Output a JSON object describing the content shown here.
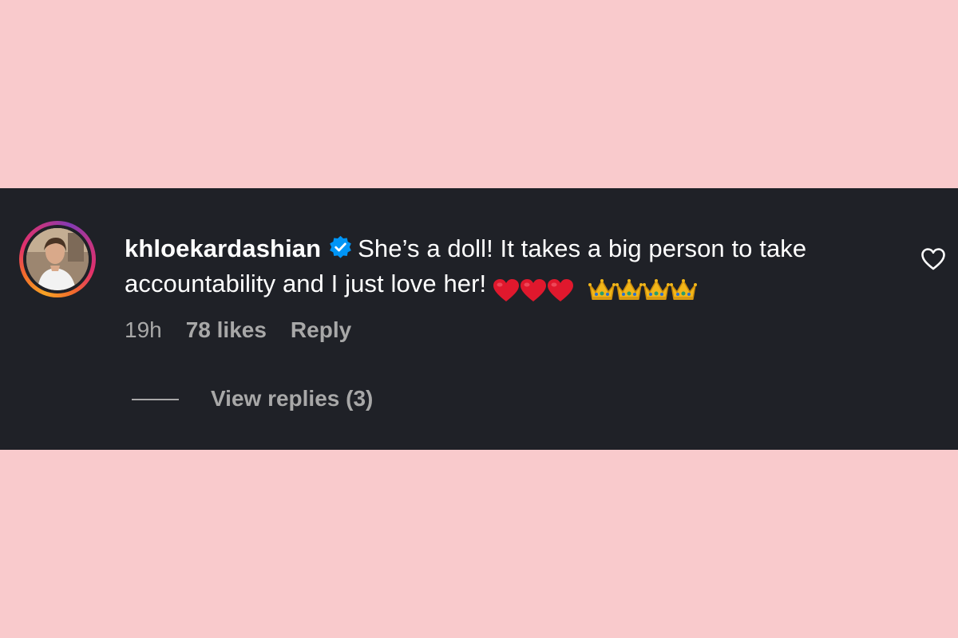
{
  "comment": {
    "username": "khloekardashian",
    "verified": true,
    "text": "She’s a doll! It takes a big person to take accountability and I just love her!",
    "text_line1": "She’s a doll! It takes a big person to take",
    "text_line2": "accountability and I just love her!",
    "emojis": [
      "red-heart",
      "red-heart",
      "red-heart",
      "crown",
      "crown",
      "crown",
      "crown"
    ],
    "time": "19h",
    "likes": "78 likes",
    "reply_label": "Reply",
    "view_replies_label": "View replies (3)"
  },
  "colors": {
    "page_background": "#f9cacc",
    "panel_background": "#1f2127",
    "text_primary": "#ffffff",
    "text_secondary": "#a8a8a8",
    "verified_badge": "#0095f6",
    "heart_emoji": "#e0182d",
    "crown_emoji": "#f2b619"
  },
  "icons": {
    "verified": "verified-badge-icon",
    "like": "heart-outline-icon"
  }
}
